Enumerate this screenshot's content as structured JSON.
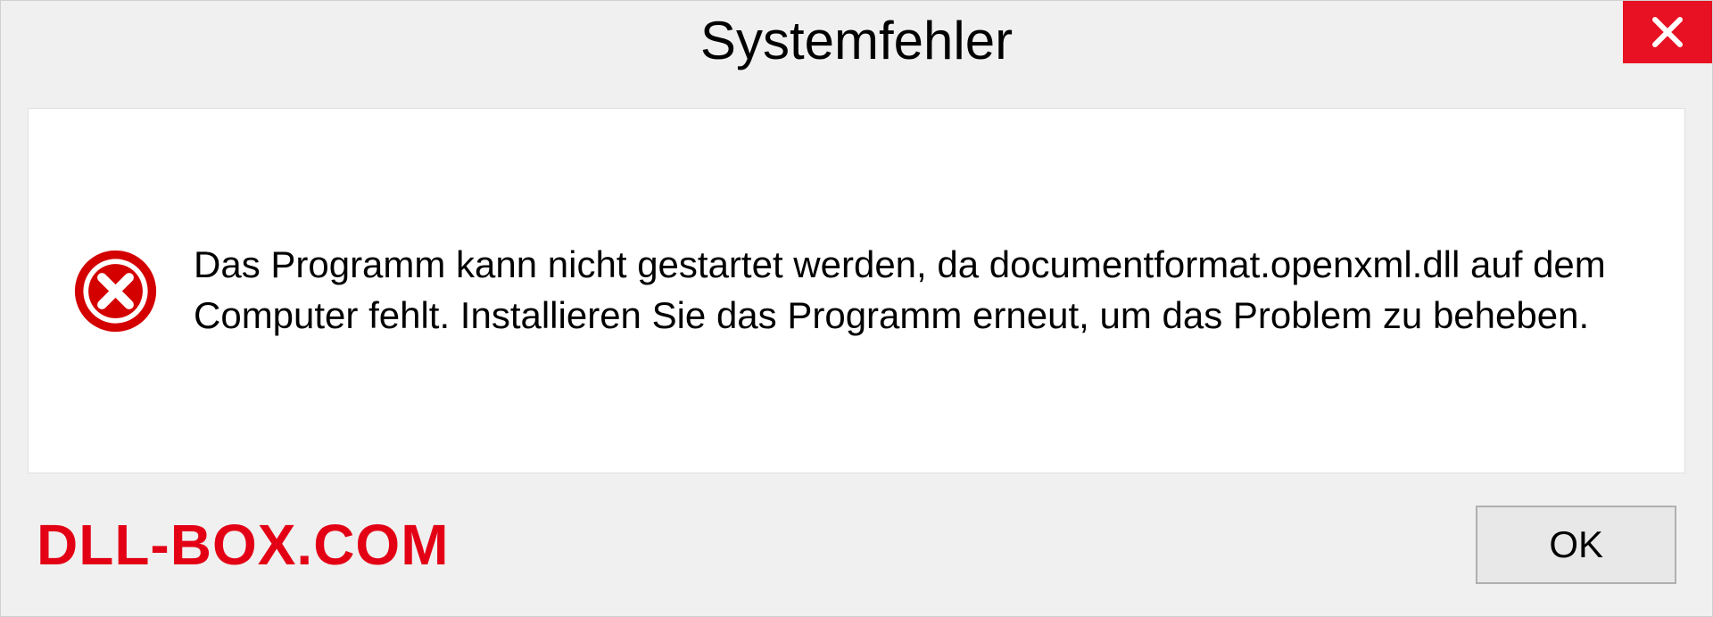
{
  "dialog": {
    "title": "Systemfehler",
    "message": "Das Programm kann nicht gestartet werden, da documentformat.openxml.dll auf dem Computer fehlt. Installieren Sie das Programm erneut, um das Problem zu beheben.",
    "ok_label": "OK"
  },
  "watermark": "DLL-BOX.COM",
  "colors": {
    "close_button": "#e81123",
    "error_icon": "#d40000",
    "watermark_text": "#e30015"
  }
}
